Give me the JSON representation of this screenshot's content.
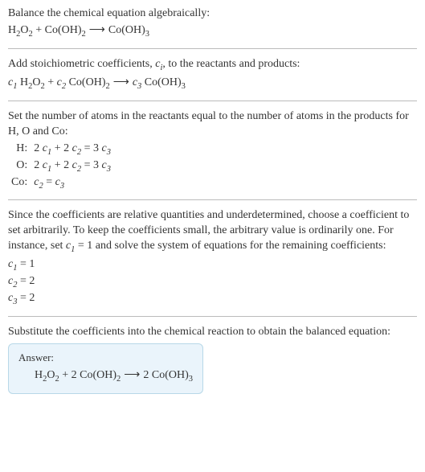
{
  "intro": {
    "line1": "Balance the chemical equation algebraically:"
  },
  "eq1": {
    "h2o2": "H",
    "h2o2_s1": "2",
    "h2o2_o": "O",
    "h2o2_s2": "2",
    "plus": " + ",
    "cooh2": "Co(OH)",
    "cooh2_s": "2",
    "arrow": "⟶",
    "cooh3": "Co(OH)",
    "cooh3_s": "3"
  },
  "step2": {
    "text_a": "Add stoichiometric coefficients, ",
    "ci": "c",
    "ci_sub": "i",
    "text_b": ", to the reactants and products:"
  },
  "eq2": {
    "c1": "c",
    "c1s": "1",
    "c2": "c",
    "c2s": "2",
    "c3": "c",
    "c3s": "3"
  },
  "step3": {
    "text": "Set the number of atoms in the reactants equal to the number of atoms in the products for H, O and Co:"
  },
  "atoms": {
    "h_label": "H:",
    "h_eq_a": "2 ",
    "h_eq_b": " + 2 ",
    "h_eq_c": " = 3 ",
    "o_label": "O:",
    "co_label": "Co:",
    "co_eq_mid": " = "
  },
  "step4": {
    "text_a": "Since the coefficients are relative quantities and underdetermined, choose a coefficient to set arbitrarily. To keep the coefficients small, the arbitrary value is ordinarily one. For instance, set ",
    "text_b": " = 1 and solve the system of equations for the remaining coefficients:"
  },
  "coeffs": {
    "c1": "c",
    "c1s": "1",
    "c1v": " = 1",
    "c2": "c",
    "c2s": "2",
    "c2v": " = 2",
    "c3": "c",
    "c3s": "3",
    "c3v": " = 2"
  },
  "step5": {
    "text": "Substitute the coefficients into the chemical reaction to obtain the balanced equation:"
  },
  "answer": {
    "label": "Answer:",
    "two": "2 "
  }
}
